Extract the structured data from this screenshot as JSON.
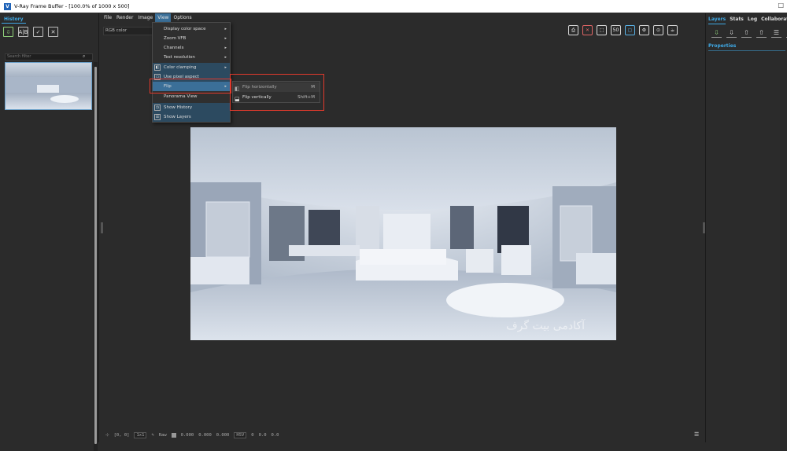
{
  "window": {
    "title": "V-Ray Frame Buffer - [100.0% of 1000 x 500]",
    "app_icon": "V"
  },
  "history": {
    "tab_label": "History",
    "search_placeholder": "Search filter"
  },
  "menu": {
    "items": [
      "File",
      "Render",
      "Image",
      "View",
      "Options"
    ],
    "active": "View"
  },
  "channel": {
    "selected": "RGB color"
  },
  "view_menu": {
    "items": [
      {
        "label": "Display color space",
        "arrow": "▸"
      },
      {
        "label": "Zoom VFB",
        "arrow": "▸"
      },
      {
        "label": "Channels",
        "arrow": "▸"
      },
      {
        "label": "Test resolution",
        "arrow": "▸"
      },
      {
        "label": "Color clamping",
        "arrow": "▸"
      },
      {
        "label": "Use pixel aspect",
        "arrow": ""
      },
      {
        "label": "Flip",
        "arrow": "▸"
      },
      {
        "label": "Panorama View",
        "arrow": ""
      },
      {
        "label": "Show History",
        "arrow": ""
      },
      {
        "label": "Show Layers",
        "arrow": ""
      }
    ]
  },
  "flip_submenu": {
    "items": [
      {
        "label": "Flip horizontally",
        "shortcut": "M"
      },
      {
        "label": "Flip vertically",
        "shortcut": "Shift+M"
      }
    ]
  },
  "render": {
    "watermark": "آکادمی بیت گرف"
  },
  "statusbar": {
    "coords": "[0, 0]",
    "zoom": "1x1",
    "raw_label": "Raw",
    "rgb_values": [
      "0.000",
      "0.000",
      "0.000"
    ],
    "color_mode": "HSV",
    "hsv_values": [
      "0",
      "0.0",
      "0.0"
    ]
  },
  "right_panel": {
    "tabs": [
      "Layers",
      "Stats",
      "Log",
      "Collaboration"
    ],
    "active_tab": "Layers",
    "properties_label": "Properties"
  },
  "colors": {
    "accent": "#3fa9e6",
    "highlight": "#e23a2c",
    "menu_active": "#3b6f98"
  }
}
